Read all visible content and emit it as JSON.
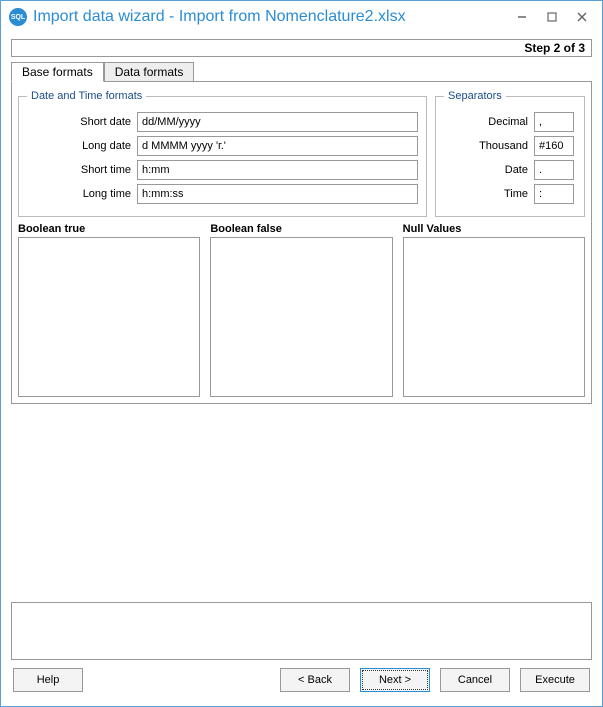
{
  "window": {
    "title": "Import data wizard - Import from Nomenclature2.xlsx"
  },
  "step": {
    "text": "Step 2 of 3"
  },
  "tabs": {
    "base": "Base formats",
    "data": "Data formats"
  },
  "groups": {
    "datetime": "Date and Time formats",
    "separators": "Separators"
  },
  "dtLabels": {
    "shortDate": "Short date",
    "longDate": "Long date",
    "shortTime": "Short time",
    "longTime": "Long time"
  },
  "dtValues": {
    "shortDate": "dd/MM/yyyy",
    "longDate": "d MMMM yyyy 'г.'",
    "shortTime": "h:mm",
    "longTime": "h:mm:ss"
  },
  "sepLabels": {
    "decimal": "Decimal",
    "thousand": "Thousand",
    "date": "Date",
    "time": "Time"
  },
  "sepValues": {
    "decimal": ",",
    "thousand": "#160",
    "date": ".",
    "time": ":"
  },
  "boolCols": {
    "true": "Boolean true",
    "false": "Boolean false",
    "null": "Null Values"
  },
  "buttons": {
    "help": "Help",
    "back": "< Back",
    "next": "Next >",
    "cancel": "Cancel",
    "execute": "Execute"
  }
}
